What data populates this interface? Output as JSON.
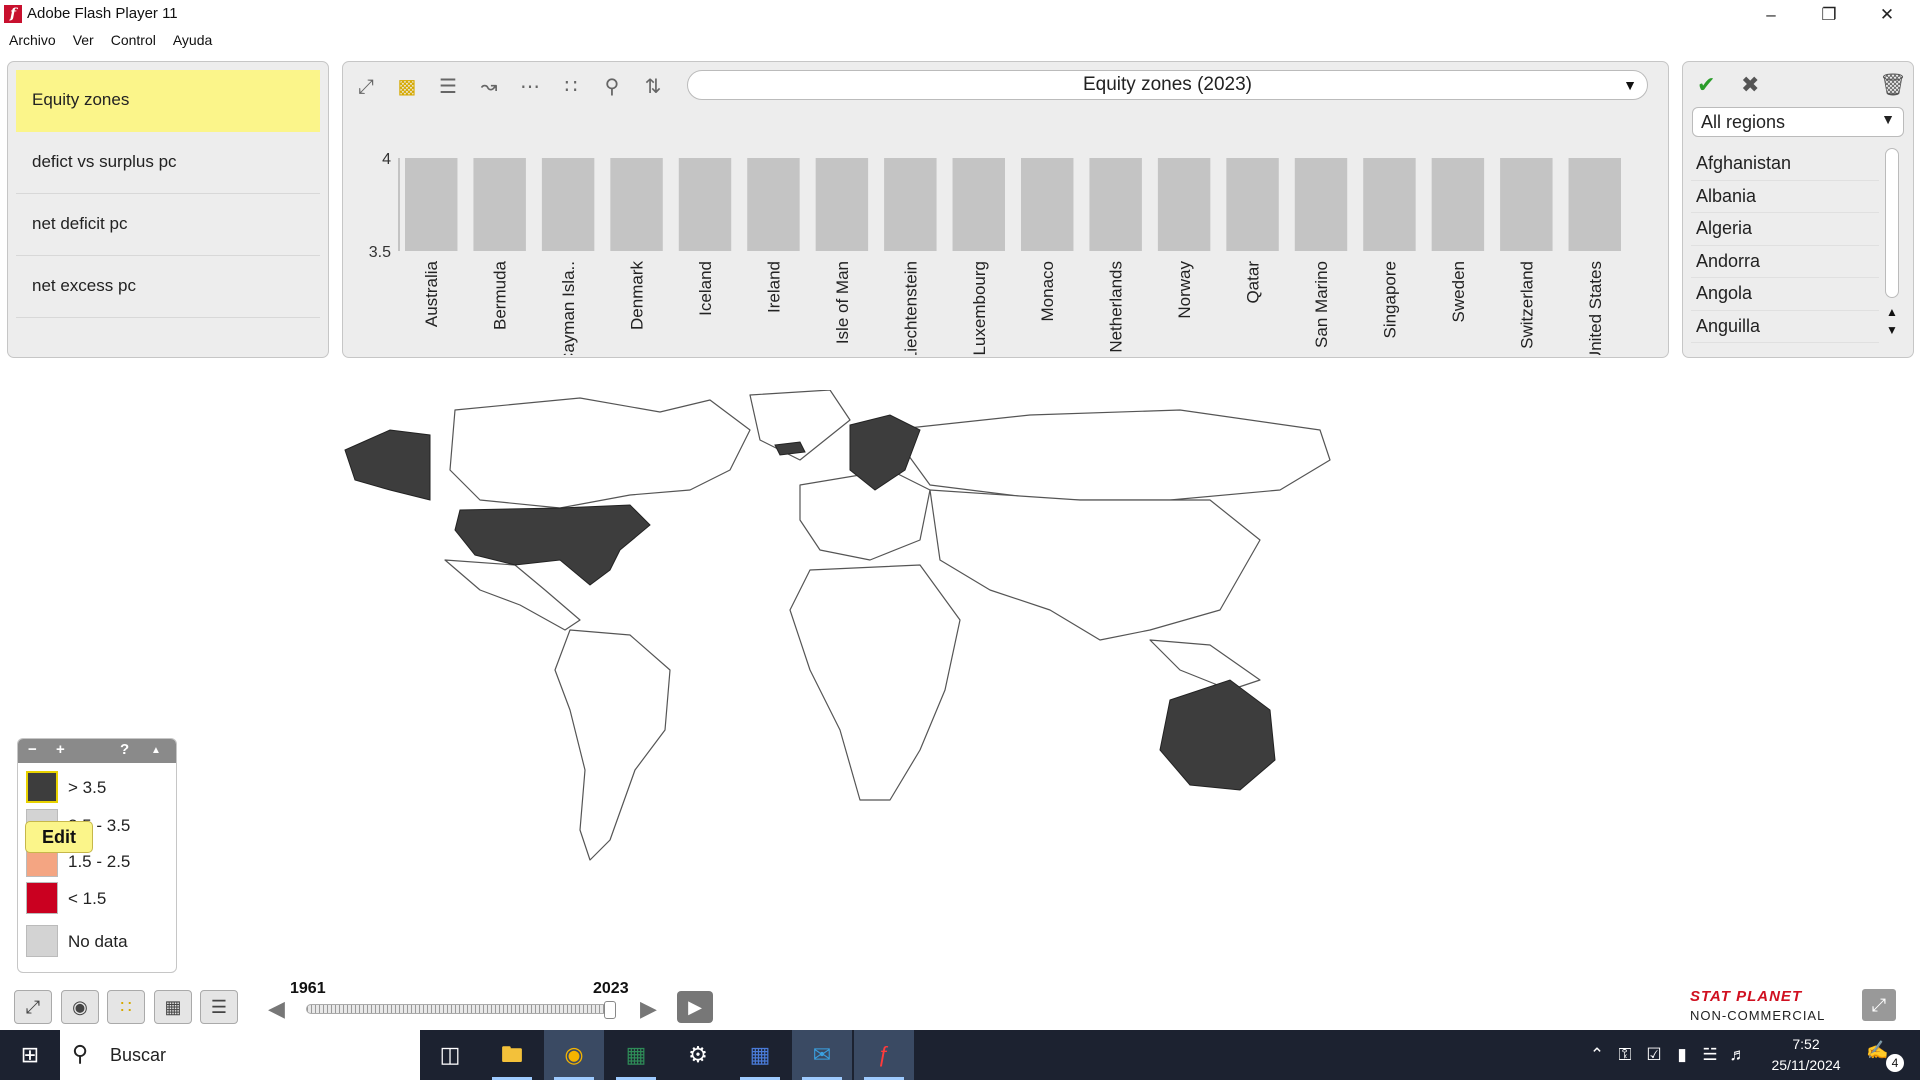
{
  "window": {
    "title": "Adobe Flash Player 11"
  },
  "menu": [
    "Archivo",
    "Ver",
    "Control",
    "Ayuda"
  ],
  "indicators": [
    "Equity zones",
    "defict vs surplus pc",
    "net deficit pc",
    "net excess pc"
  ],
  "toolbar": {
    "selected_indicator": "Equity zones (2023)"
  },
  "chart_data": {
    "type": "bar",
    "categories": [
      "Australia",
      "Bermuda",
      "Cayman Isla..",
      "Denmark",
      "Iceland",
      "Ireland",
      "Isle of Man",
      "Liechtenstein",
      "Luxembourg",
      "Monaco",
      "Netherlands",
      "Norway",
      "Qatar",
      "San Marino",
      "Singapore",
      "Sweden",
      "Switzerland",
      "United States"
    ],
    "values": [
      4,
      4,
      4,
      4,
      4,
      4,
      4,
      4,
      4,
      4,
      4,
      4,
      4,
      4,
      4,
      4,
      4,
      4
    ],
    "yticks": [
      "4",
      "3.5"
    ],
    "ylim": [
      3.5,
      4
    ],
    "bar_color": "#c4c4c4"
  },
  "regions": {
    "selected": "All regions",
    "countries": [
      "Afghanistan",
      "Albania",
      "Algeria",
      "Andorra",
      "Angola",
      "Anguilla"
    ]
  },
  "legend": {
    "controls": [
      "−",
      "+",
      "?",
      "▲"
    ],
    "items": [
      {
        "label": "> 3.5",
        "color": "#3d3d3d"
      },
      {
        "label": "2.5 - 3.5",
        "color": "#d3d3d3"
      },
      {
        "label": "1.5 - 2.5",
        "color": "#f4a582"
      },
      {
        "label": "< 1.5",
        "color": "#ca0020"
      },
      {
        "label": "No data",
        "color": "#d3d3d3"
      }
    ],
    "tooltip": "Edit"
  },
  "timeline": {
    "start": "1961",
    "end": "2023"
  },
  "brand": {
    "line1": "STAT PLANET",
    "line2": "NON-COMMERCIAL"
  },
  "taskbar": {
    "search_placeholder": "Buscar",
    "time": "7:52",
    "date": "25/11/2024",
    "notifications": "4"
  }
}
